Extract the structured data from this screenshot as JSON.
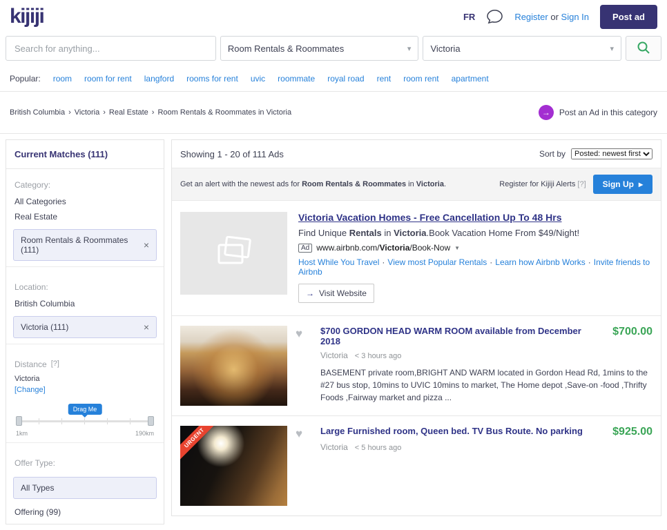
{
  "header": {
    "logo": "kijiji",
    "language": "FR",
    "register": "Register",
    "or_text": "or",
    "sign_in": "Sign In",
    "post_ad": "Post ad"
  },
  "search": {
    "placeholder": "Search for anything...",
    "category": "Room Rentals & Roommates",
    "location": "Victoria"
  },
  "popular": {
    "label": "Popular:",
    "links": [
      "room",
      "room for rent",
      "langford",
      "rooms for rent",
      "uvic",
      "roommate",
      "royal road",
      "rent",
      "room rent",
      "apartment"
    ]
  },
  "breadcrumb": {
    "items": [
      "British Columbia",
      "Victoria",
      "Real Estate",
      "Room Rentals & Roommates in Victoria"
    ],
    "separator": "›",
    "post_ad_link": "Post an Ad in this category"
  },
  "sidebar": {
    "title": "Current Matches",
    "count": "(111)",
    "category": {
      "label": "Category:",
      "items": [
        "All Categories",
        "Real Estate"
      ],
      "selected": "Room Rentals & Roommates (111)",
      "close": "×"
    },
    "location": {
      "label": "Location:",
      "items": [
        "British Columbia"
      ],
      "selected": "Victoria (111)",
      "close": "×"
    },
    "distance": {
      "label": "Distance",
      "help": "[?]",
      "place": "Victoria",
      "change": "[Change]",
      "tooltip": "Drag Me",
      "min": "1km",
      "max": "190km"
    },
    "offer": {
      "label": "Offer Type:",
      "selected": "All Types",
      "items": [
        "Offering (99)"
      ]
    }
  },
  "results": {
    "showing": "Showing 1 - 20 of 111 Ads",
    "sort_label": "Sort by",
    "sort_value": "Posted: newest first",
    "alert": {
      "prefix": "Get an alert with the newest ads for",
      "category": "Room Rentals & Roommates",
      "mid": "in",
      "location": "Victoria",
      "suffix": ".",
      "register": "Register for Kijiji Alerts",
      "help": "[?]",
      "sign_up": "Sign Up",
      "arrow": "▸"
    }
  },
  "sponsored": {
    "title": "Victoria Vacation Homes - Free Cancellation Up To 48 Hrs",
    "desc_1": "Find Unique",
    "desc_bold_1": "Rentals",
    "desc_2": "in",
    "desc_bold_2": "Victoria",
    "desc_3": ".Book Vacation Home From $49/Night!",
    "ad_badge": "Ad",
    "url_1": "www.airbnb.com/",
    "url_bold": "Victoria",
    "url_2": "/Book-Now",
    "sitelinks": [
      "Host While You Travel",
      "View most Popular Rentals",
      "Learn how Airbnb Works",
      "Invite friends to Airbnb"
    ],
    "separator": "·",
    "visit": "Visit Website"
  },
  "listings": [
    {
      "title": "$700 GORDON HEAD WARM ROOM available from December 2018",
      "price": "$700.00",
      "location": "Victoria",
      "time": "< 3 hours ago",
      "description": "BASEMENT private room,BRIGHT AND WARM located in Gordon Head Rd, 1mins to the #27 bus stop, 10mins to UVIC 10mins to market, The Home depot ,Save-on -food ,Thrifty Foods ,Fairway market and pizza ..."
    },
    {
      "title": "Large Furnished room, Queen bed. TV Bus Route. No parking",
      "price": "$925.00",
      "location": "Victoria",
      "time": "< 5 hours ago",
      "urgent": "URGENT",
      "description": ""
    }
  ],
  "icons": {
    "chevron_down": "▾",
    "select_arrow": "▼",
    "heart": "♥",
    "arrow_right": "→"
  },
  "colors": {
    "brand_purple": "#373373",
    "link_blue": "#2681da",
    "price_green": "#3aa556",
    "urgent_red": "#e8432f"
  }
}
